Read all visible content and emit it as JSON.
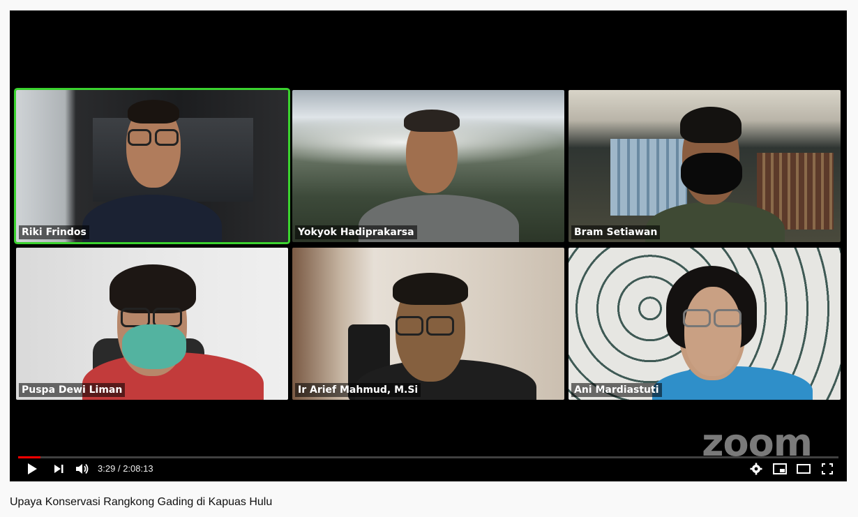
{
  "video": {
    "title": "Upaya Konservasi Rangkong Gading di Kapuas Hulu",
    "time_current": "3:29",
    "time_separator": "/",
    "time_total": "2:08:13",
    "progress_fraction": 0.027,
    "logo_text": "zoom"
  },
  "participants": [
    {
      "name": "Riki Frindos",
      "active": true
    },
    {
      "name": "Yokyok Hadiprakarsa",
      "active": false
    },
    {
      "name": "Bram Setiawan",
      "active": false
    },
    {
      "name": "Puspa Dewi Liman",
      "active": false
    },
    {
      "name": "Ir Arief Mahmud, M.Si",
      "active": false
    },
    {
      "name": "Ani Mardiastuti",
      "active": false
    }
  ],
  "colors": {
    "active_border": "#3bd22f",
    "progress": "#ff0000",
    "player_bg": "#000000"
  },
  "icons": [
    "play-icon",
    "next-icon",
    "volume-icon",
    "settings-icon",
    "miniplayer-icon",
    "theater-icon",
    "fullscreen-icon"
  ]
}
